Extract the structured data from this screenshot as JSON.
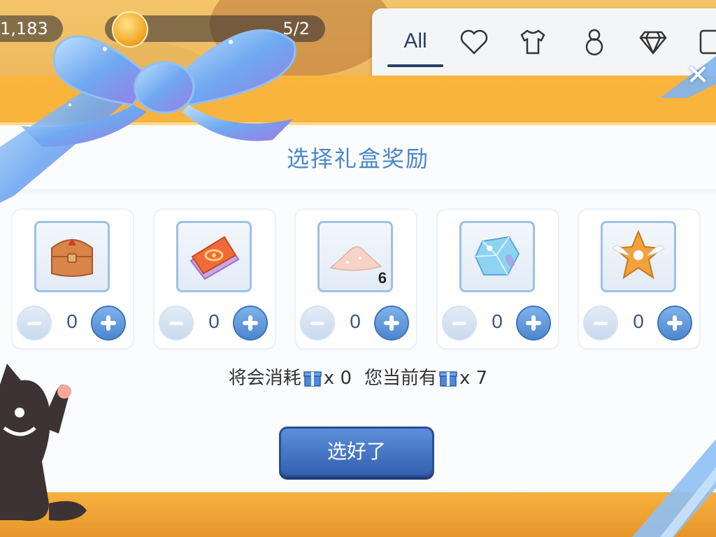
{
  "topbar": {
    "left_value": "1,183",
    "mid_value": "5/2"
  },
  "tabs": [
    {
      "label": "All",
      "active": true
    },
    {
      "icon": "heart-icon"
    },
    {
      "icon": "shirt-icon"
    },
    {
      "icon": "gourd-icon"
    },
    {
      "icon": "diamond-icon"
    },
    {
      "icon": "frame-icon"
    }
  ],
  "modal": {
    "title": "选择礼盒奖励",
    "close_icon": "close-icon",
    "rewards": [
      {
        "item_icon": "chest-icon",
        "count_badge": "",
        "quantity": "0"
      },
      {
        "item_icon": "card-pack-icon",
        "count_badge": "",
        "quantity": "0"
      },
      {
        "item_icon": "powder-icon",
        "count_badge": "6",
        "quantity": "0"
      },
      {
        "item_icon": "crystal-icon",
        "count_badge": "",
        "quantity": "0"
      },
      {
        "item_icon": "winged-badge-icon",
        "count_badge": "",
        "quantity": "0"
      }
    ],
    "consume": {
      "will_consume_label": "将会消耗",
      "will_consume_value": "x 0",
      "you_have_label": "您当前有",
      "you_have_value": "x 7"
    },
    "confirm_label": "选好了"
  },
  "colors": {
    "accent_blue": "#4a86c8",
    "button_blue": "#3460b0",
    "frame_orange": "#f4a533",
    "panel_white": "#fbfcfe"
  }
}
